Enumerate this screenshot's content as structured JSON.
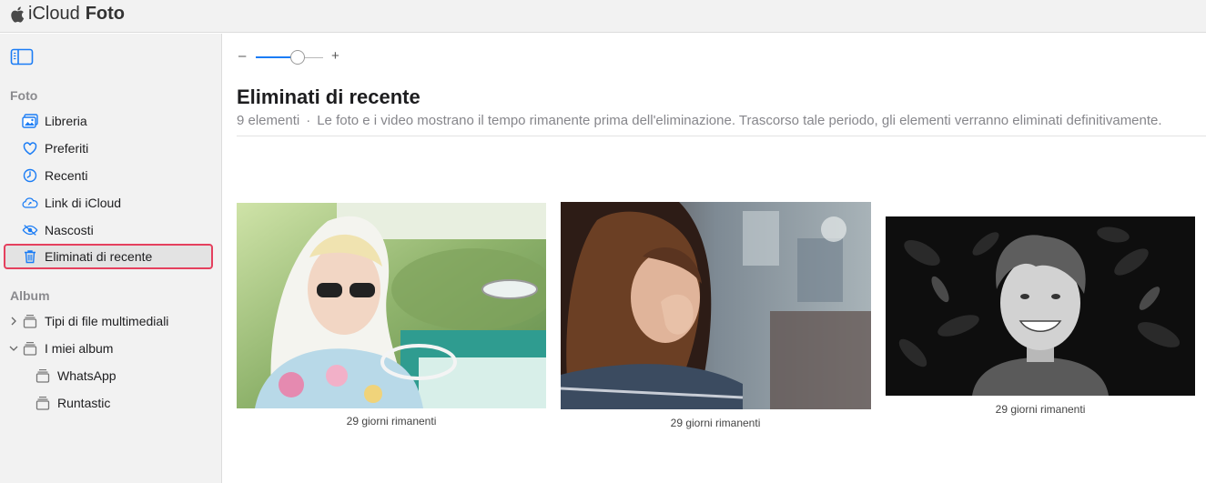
{
  "app": {
    "name": "iCloud",
    "section": "Foto"
  },
  "icons": {
    "apple": "apple-logo-icon",
    "sidebar_toggle": "sidebar-toggle-icon"
  },
  "colors": {
    "accent": "#1a7cf5",
    "highlight": "#e5405e"
  },
  "sidebar": {
    "foto_label": "Foto",
    "foto_items": [
      {
        "label": "Libreria",
        "icon": "photo-library-icon"
      },
      {
        "label": "Preferiti",
        "icon": "heart-icon"
      },
      {
        "label": "Recenti",
        "icon": "clock-icon"
      },
      {
        "label": "Link di iCloud",
        "icon": "cloud-link-icon"
      },
      {
        "label": "Nascosti",
        "icon": "eye-slash-icon"
      },
      {
        "label": "Eliminati di recente",
        "icon": "trash-icon",
        "selected": true
      }
    ],
    "album_label": "Album",
    "album_items": [
      {
        "label": "Tipi di file multimediali",
        "icon": "album-stack-icon",
        "expanded": false
      },
      {
        "label": "I miei album",
        "icon": "album-stack-icon",
        "expanded": true
      },
      {
        "label": "WhatsApp",
        "icon": "album-stack-icon"
      },
      {
        "label": "Runtastic",
        "icon": "album-stack-icon"
      }
    ]
  },
  "toolbar": {
    "zoom_minus": "–",
    "zoom_plus": "+",
    "zoom_level": 0.62
  },
  "main": {
    "title": "Eliminati di recente",
    "count": "9 elementi",
    "separator": "·",
    "description": "Le foto e i video mostrano il tempo rimanente prima dell'eliminazione. Trascorso tale periodo, gli elementi verranno eliminati definitivamente."
  },
  "photos": [
    {
      "caption": "29 giorni rimanenti",
      "subject": "woman-in-vintage-car"
    },
    {
      "caption": "29 giorni rimanenti",
      "subject": "woman-praying"
    },
    {
      "caption": "29 giorni rimanenti",
      "subject": "smiling-man-bw"
    }
  ]
}
